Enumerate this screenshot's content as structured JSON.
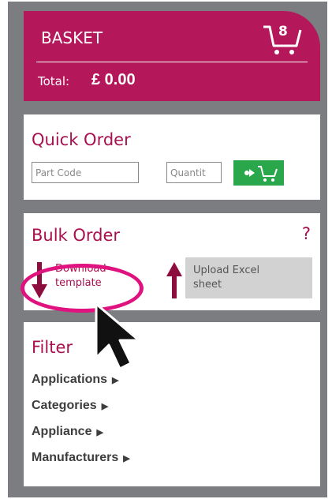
{
  "basket": {
    "title": "BASKET",
    "item_count": "8",
    "total_label": "Total:",
    "total_value": "£ 0.00"
  },
  "quick_order": {
    "title": "Quick Order",
    "part_code_placeholder": "Part Code",
    "quantity_placeholder": "Quantit"
  },
  "bulk_order": {
    "title": "Bulk Order",
    "help": "?",
    "download_line1": "Download",
    "download_line2": "template",
    "upload_line1": "Upload Excel",
    "upload_line2": "sheet"
  },
  "filter": {
    "title": "Filter",
    "items": [
      {
        "label": "Applications"
      },
      {
        "label": "Categories"
      },
      {
        "label": "Appliance"
      },
      {
        "label": "Manufacturers"
      }
    ]
  },
  "colors": {
    "brand": "#b5175b",
    "highlight": "#e0127f",
    "add_button": "#2aa64b",
    "frame": "#7b7d80"
  }
}
